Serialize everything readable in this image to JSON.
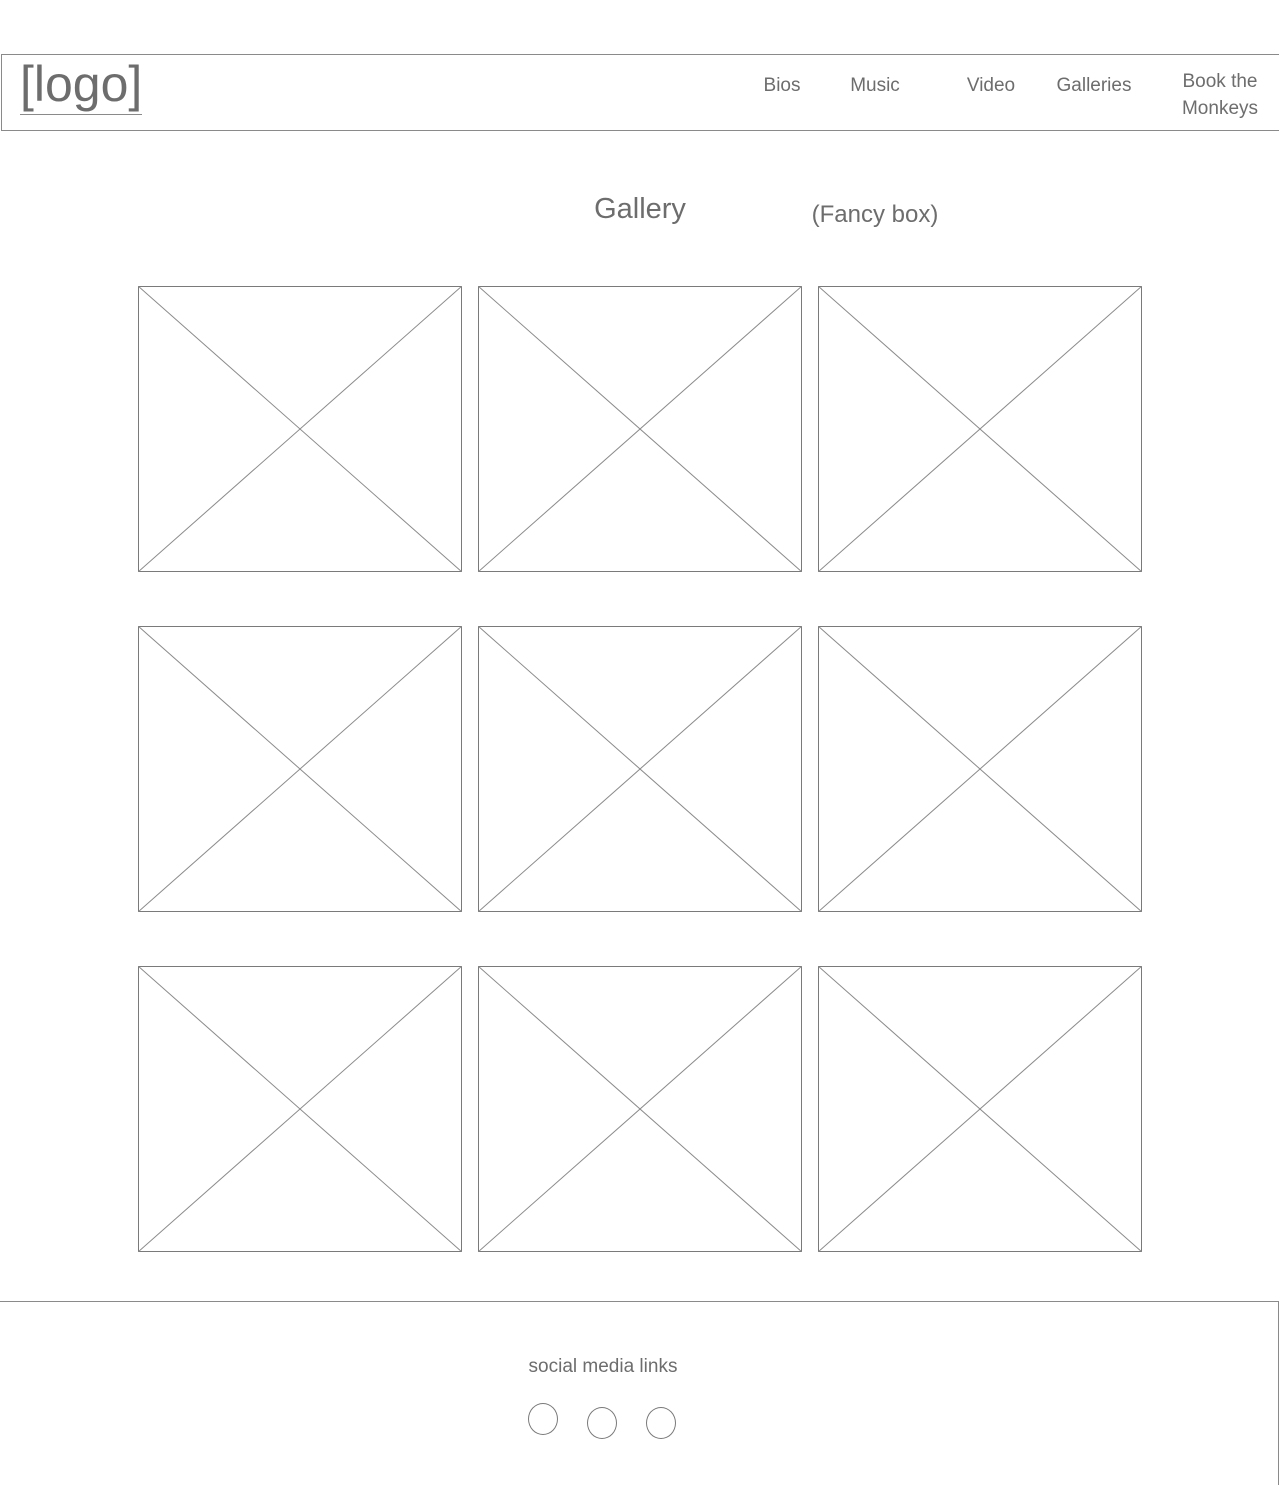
{
  "header": {
    "logo": "[logo]",
    "nav": {
      "bios": "Bios",
      "music": "Music",
      "video": "Video",
      "galleries": "Galleries",
      "book_line1": "Book the",
      "book_line2": "Monkeys"
    }
  },
  "main": {
    "title": "Gallery",
    "note": "(Fancy box)",
    "thumbnail_count": 9
  },
  "footer": {
    "social_label": "social media links",
    "social_link_count": 3
  }
}
